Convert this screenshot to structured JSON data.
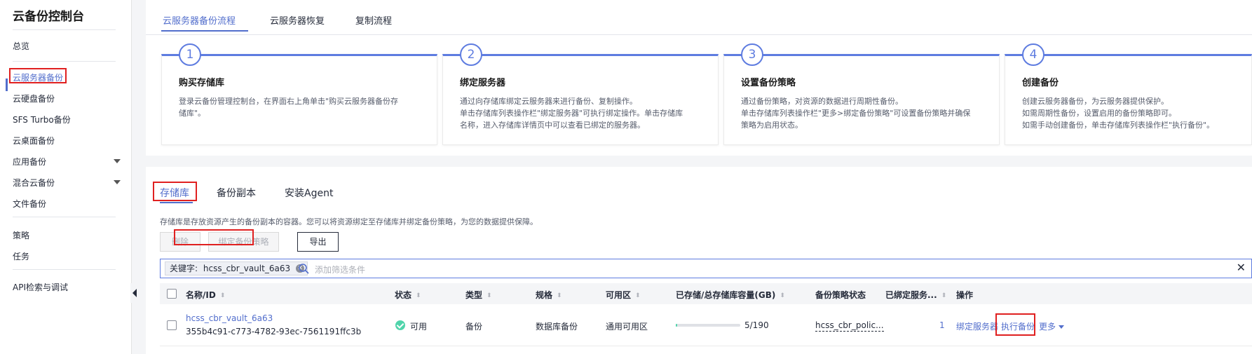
{
  "sidebar": {
    "title": "云备份控制台",
    "items": [
      {
        "label": "总览"
      },
      {
        "label": "云服务器备份"
      },
      {
        "label": "云硬盘备份"
      },
      {
        "label": "SFS Turbo备份"
      },
      {
        "label": "云桌面备份"
      },
      {
        "label": "应用备份"
      },
      {
        "label": "混合云备份"
      },
      {
        "label": "文件备份"
      },
      {
        "label": "策略"
      },
      {
        "label": "任务"
      },
      {
        "label": "API检索与调试"
      }
    ]
  },
  "top_tabs": [
    {
      "label": "云服务器备份流程"
    },
    {
      "label": "云服务器恢复"
    },
    {
      "label": "复制流程"
    }
  ],
  "steps": [
    {
      "num": "1",
      "title": "购买存储库",
      "desc": "登录云备份管理控制台，在界面右上角单击\"购买云服务器备份存\n储库\"。"
    },
    {
      "num": "2",
      "title": "绑定服务器",
      "desc": "通过向存储库绑定云服务器来进行备份、复制操作。\n单击存储库列表操作栏\"绑定服务器\"可执行绑定操作。单击存储库\n名称，进入存储库详情页中可以查看已绑定的服务器。"
    },
    {
      "num": "3",
      "title": "设置备份策略",
      "desc": "通过备份策略，对资源的数据进行周期性备份。\n单击存储库列表操作栏\"更多>绑定备份策略\"可设置备份策略并确保\n策略为启用状态。"
    },
    {
      "num": "4",
      "title": "创建备份",
      "desc": "创建云服务器备份，为云服务器提供保护。\n如需周期性备份，设置启用的备份策略即可。\n如需手动创建备份，单击存储库列表操作栏\"执行备份\"。"
    }
  ],
  "sub_tabs": [
    {
      "label": "存储库"
    },
    {
      "label": "备份副本"
    },
    {
      "label": "安装Agent"
    }
  ],
  "description": "存储库是存放资源产生的备份副本的容器。您可以将资源绑定至存储库并绑定备份策略，为您的数据提供保障。",
  "toolbar": {
    "delete_label": "删除",
    "bind_policy_label": "绑定备份策略",
    "export_label": "导出"
  },
  "filter": {
    "chip_label": "关键字:",
    "chip_value": "hcss_cbr_vault_6a63",
    "placeholder": "添加筛选条件"
  },
  "table": {
    "headers": [
      "名称/ID",
      "状态",
      "类型",
      "规格",
      "可用区",
      "已存储/总存储库容量(GB)",
      "备份策略状态",
      "已绑定服务...",
      "操作"
    ],
    "rows": [
      {
        "name": "hcss_cbr_vault_6a63",
        "id": "355b4c91-c773-4782-93ec-7561191ffc3b",
        "status": "可用",
        "type": "备份",
        "spec": "数据库备份",
        "az": "通用可用区",
        "usage": "5/190",
        "usage_fraction": 0.026,
        "policy": "hcss_cbr_polic...",
        "bound": "1",
        "actions": {
          "bind": "绑定服务器",
          "execute": "执行备份",
          "more": "更多"
        }
      }
    ]
  },
  "colors": {
    "accent": "#526ecc",
    "step_line": "#5e7ce0",
    "status_ok": "#50d4ab",
    "highlight": "#e02020"
  }
}
